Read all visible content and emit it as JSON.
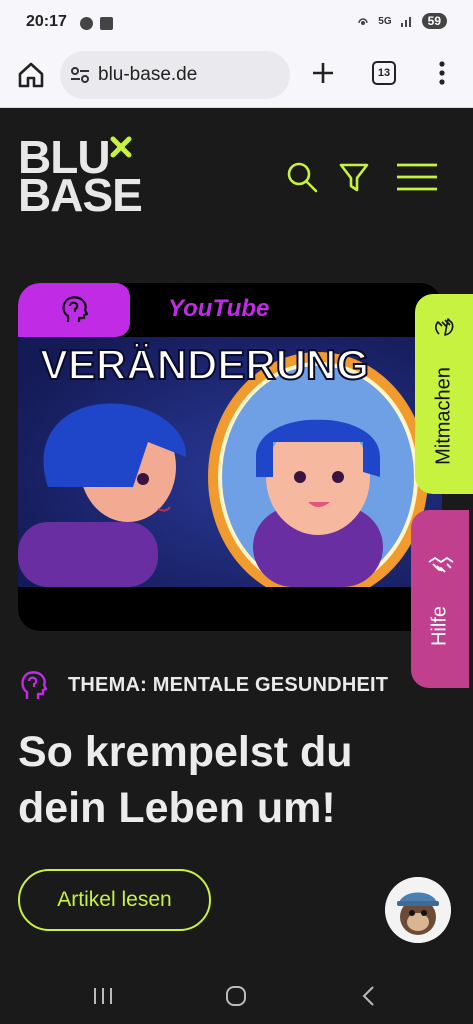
{
  "status_bar": {
    "time": "20:17",
    "network": "5G",
    "battery": "59"
  },
  "browser": {
    "url": "blu-base.de",
    "tab_count": "13"
  },
  "site": {
    "logo_line1": "BLU",
    "logo_line2": "BASE",
    "accent_color": "#c7f23f",
    "purple_color": "#c02be6"
  },
  "card": {
    "source_label": "YouTube",
    "image_caption": "VERÄNDERUNG"
  },
  "side_tabs": {
    "mitmachen": "Mitmachen",
    "hilfe": "Hilfe"
  },
  "article": {
    "theme": "THEMA: MENTALE GESUNDHEIT",
    "headline": "So krempelst du dein Leben um!",
    "button_label": "Artikel lesen"
  }
}
